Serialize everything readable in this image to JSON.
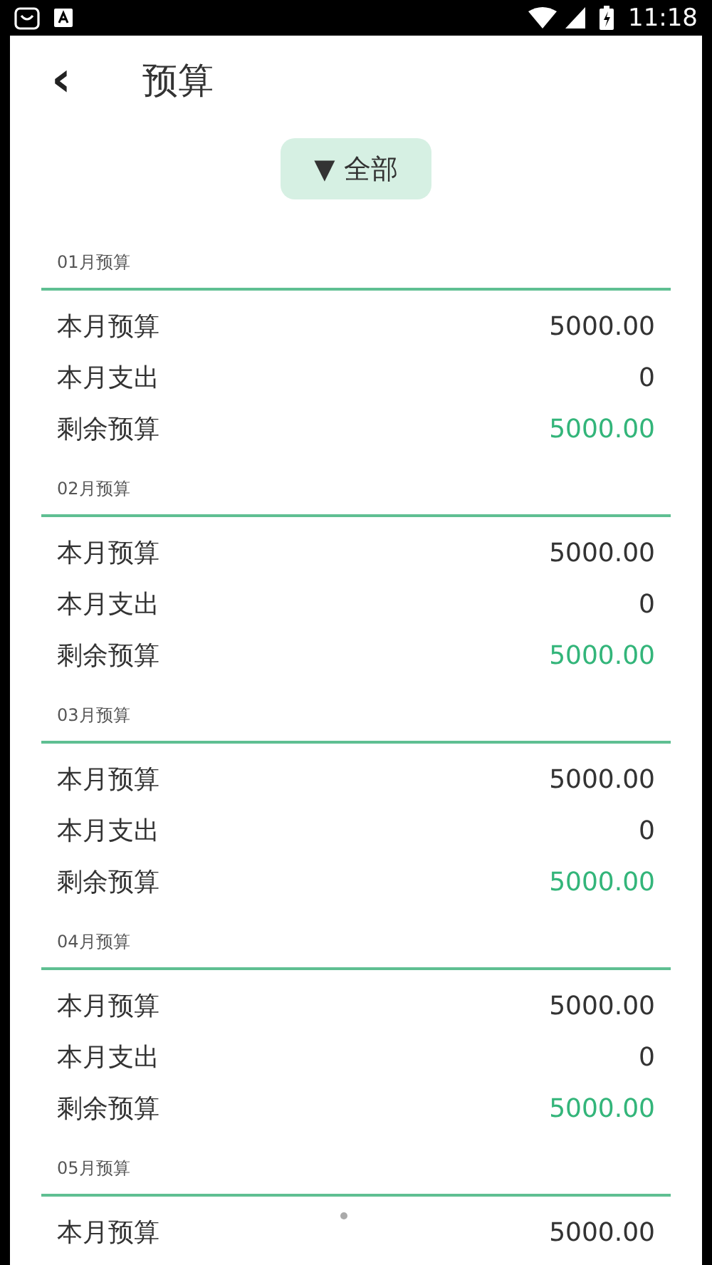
{
  "status_bar": {
    "time": "11:18"
  },
  "header": {
    "back": "‹",
    "title": "预算"
  },
  "filter": {
    "arrow": "▼",
    "label": "全部"
  },
  "months": [
    {
      "label": "01月预算",
      "rows": [
        {
          "kind": "plain",
          "name": "本月预算",
          "value": "5000.00"
        },
        {
          "kind": "plain",
          "name": "本月支出",
          "value": "0"
        },
        {
          "kind": "remaining",
          "name": "剩余预算",
          "value": "5000.00"
        }
      ]
    },
    {
      "label": "02月预算",
      "rows": [
        {
          "kind": "plain",
          "name": "本月预算",
          "value": "5000.00"
        },
        {
          "kind": "plain",
          "name": "本月支出",
          "value": "0"
        },
        {
          "kind": "remaining",
          "name": "剩余预算",
          "value": "5000.00"
        }
      ]
    },
    {
      "label": "03月预算",
      "rows": [
        {
          "kind": "plain",
          "name": "本月预算",
          "value": "5000.00"
        },
        {
          "kind": "plain",
          "name": "本月支出",
          "value": "0"
        },
        {
          "kind": "remaining",
          "name": "剩余预算",
          "value": "5000.00"
        }
      ]
    },
    {
      "label": "04月预算",
      "rows": [
        {
          "kind": "plain",
          "name": "本月预算",
          "value": "5000.00"
        },
        {
          "kind": "plain",
          "name": "本月支出",
          "value": "0"
        },
        {
          "kind": "remaining",
          "name": "剩余预算",
          "value": "5000.00"
        }
      ]
    },
    {
      "label": "05月预算",
      "rows": [
        {
          "kind": "plain",
          "name": "本月预算",
          "value": "5000.00"
        }
      ]
    }
  ]
}
